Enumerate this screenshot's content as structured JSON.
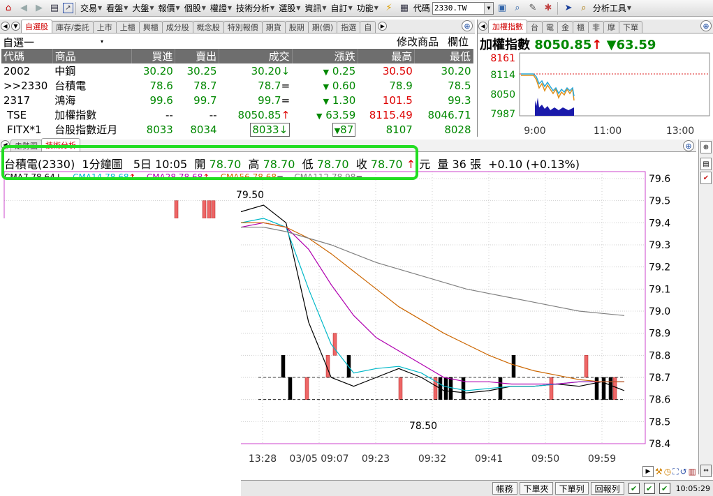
{
  "toolbar": {
    "menus": [
      "交易",
      "看盤",
      "大盤",
      "報價",
      "個股",
      "權證",
      "技術分析",
      "選股",
      "資訊",
      "自訂",
      "功能"
    ],
    "code_label": "代碼",
    "code_value": "2330.TW",
    "analysis_tools": "分析工具"
  },
  "watchlist": {
    "tabs": [
      "自選股",
      "庫存/委託",
      "上市",
      "上櫃",
      "興櫃",
      "成分股",
      "概念股",
      "特別報價",
      "期貨",
      "股期",
      "期(價)",
      "指選",
      "自"
    ],
    "group_name": "自選一",
    "edit_label": "修改商品",
    "column_label": "欄位",
    "headers": [
      "代碼",
      "商品",
      "買進",
      "賣出",
      "成交",
      "漲跌",
      "最高",
      "最低"
    ],
    "rows": [
      {
        "code": "2002",
        "name": "中鋼",
        "bid": "30.20",
        "ask": "30.25",
        "last": "30.20",
        "last_mark": "↓",
        "change": "0.25",
        "high": "30.50",
        "low": "30.20"
      },
      {
        "code": ">>2330",
        "name": "台積電",
        "bid": "78.6",
        "ask": "78.7",
        "last": "78.7",
        "last_mark": "=",
        "change": "0.60",
        "high": "78.9",
        "low": "78.5"
      },
      {
        "code": "2317",
        "name": "鴻海",
        "bid": "99.6",
        "ask": "99.7",
        "last": "99.7",
        "last_mark": "=",
        "change": "1.30",
        "high": "101.5",
        "low": "99.3"
      },
      {
        "code": "TSE",
        "name": "加權指數",
        "bid": "--",
        "ask": "--",
        "last": "8050.85",
        "last_mark": "↑",
        "change": "63.59",
        "high": "8115.49",
        "low": "8046.71"
      },
      {
        "code": "FITX*1",
        "name": "台股指數近月",
        "bid": "8033",
        "ask": "8034",
        "last": "8033",
        "last_mark": "↓",
        "change": "87",
        "high": "8107",
        "low": "8028"
      }
    ]
  },
  "index_panel": {
    "tabs": [
      "加權指數",
      "台",
      "電",
      "金",
      "櫃",
      "非",
      "摩",
      "下單"
    ],
    "name": "加權指數",
    "value": "8050.85",
    "change": "63.59",
    "y_ticks": [
      "8161",
      "8114",
      "8050",
      "7987"
    ],
    "x_ticks": [
      "9:00",
      "11:00",
      "13:00"
    ]
  },
  "main_chart": {
    "tabs": [
      "走勢圖",
      "技術分析"
    ],
    "stock": "台積電(2330)",
    "period": "1分鐘圖",
    "days": "5日",
    "time": "10:05",
    "open_label": "開",
    "open": "78.70",
    "high_label": "高",
    "high": "78.70",
    "low_label": "低",
    "low": "78.70",
    "close_label": "收",
    "close": "78.70",
    "unit": "元",
    "volume_label": "量",
    "volume": "36",
    "volume_unit": "張",
    "change": "+0.10 (+0.13%)",
    "ma": [
      {
        "label": "CMA7",
        "value": "78.64",
        "mark": "↓",
        "color": "#000000"
      },
      {
        "label": "CMA14",
        "value": "78.68",
        "mark": "↑",
        "color": "#00b8c8"
      },
      {
        "label": "CMA28",
        "value": "78.68",
        "mark": "↑",
        "color": "#b000b0"
      },
      {
        "label": "CMA56",
        "value": "78.68",
        "mark": "=",
        "color": "#cc6600"
      },
      {
        "label": "CMA112",
        "value": "78.98",
        "mark": "=",
        "color": "#808080"
      }
    ]
  },
  "chart_data": {
    "type": "line",
    "y_ticks": [
      "79.6",
      "79.5",
      "79.4",
      "79.3",
      "79.2",
      "79.1",
      "79.0",
      "78.9",
      "78.8",
      "78.7",
      "78.6",
      "78.5",
      "78.4"
    ],
    "ylim": [
      78.4,
      79.6
    ],
    "x_ticks": [
      "13:28",
      "03/05 09:07",
      "09:23",
      "09:32",
      "09:41",
      "09:50",
      "09:59"
    ],
    "peak_label": "79.50",
    "trough_label": "78.50",
    "series": [
      {
        "name": "CMA7",
        "values": [
          79.45,
          79.48,
          79.4,
          78.95,
          78.7,
          78.66,
          78.7,
          78.74,
          78.7,
          78.64,
          78.63,
          78.64,
          78.66,
          78.66,
          78.67,
          78.66,
          78.68,
          78.64
        ]
      },
      {
        "name": "CMA14",
        "values": [
          79.4,
          79.42,
          79.38,
          79.1,
          78.85,
          78.72,
          78.74,
          78.75,
          78.72,
          78.66,
          78.64,
          78.65,
          78.66,
          78.66,
          78.67,
          78.68,
          78.68,
          78.68
        ]
      },
      {
        "name": "CMA28",
        "values": [
          79.38,
          79.4,
          79.38,
          79.28,
          79.12,
          78.98,
          78.88,
          78.82,
          78.76,
          78.7,
          78.68,
          78.68,
          78.67,
          78.67,
          78.67,
          78.68,
          78.68,
          78.68
        ]
      },
      {
        "name": "CMA56",
        "values": [
          79.4,
          79.4,
          79.38,
          79.33,
          79.26,
          79.18,
          79.1,
          79.02,
          78.96,
          78.9,
          78.85,
          78.8,
          78.76,
          78.73,
          78.71,
          78.69,
          78.68,
          78.68
        ]
      },
      {
        "name": "CMA112",
        "values": [
          79.38,
          79.38,
          79.36,
          79.33,
          79.3,
          79.26,
          79.22,
          79.19,
          79.16,
          79.13,
          79.1,
          79.08,
          79.06,
          79.04,
          79.02,
          79.0,
          78.99,
          78.98
        ]
      }
    ]
  },
  "statusbar": {
    "buttons": [
      "帳務",
      "下單夾",
      "下單列",
      "回報列"
    ],
    "clock": "10:05:29"
  }
}
